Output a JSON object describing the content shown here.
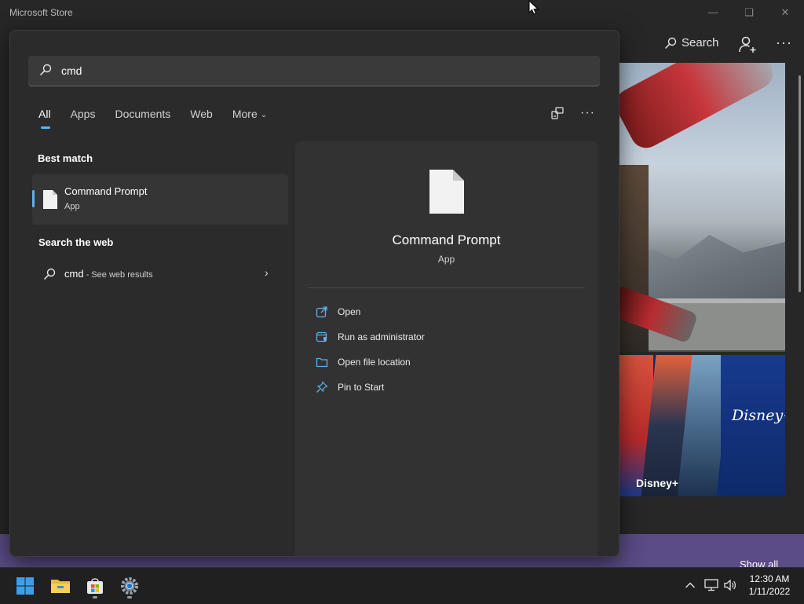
{
  "store": {
    "title": "Microsoft Store",
    "search_label": "Search",
    "promo_label": "Disney+",
    "promo_logo": "Disney+",
    "show_all": "Show all"
  },
  "search": {
    "query": "cmd",
    "tabs": [
      {
        "label": "All",
        "active": true
      },
      {
        "label": "Apps"
      },
      {
        "label": "Documents"
      },
      {
        "label": "Web"
      },
      {
        "label": "More"
      }
    ]
  },
  "results": {
    "best_match_heading": "Best match",
    "best_match": {
      "name": "Command Prompt",
      "type": "App"
    },
    "web_heading": "Search the web",
    "web_result": {
      "query": "cmd",
      "suffix": " - See web results"
    }
  },
  "detail": {
    "name": "Command Prompt",
    "type": "App",
    "actions": [
      {
        "label": "Open",
        "icon": "open-icon"
      },
      {
        "label": "Run as administrator",
        "icon": "shield-admin-icon"
      },
      {
        "label": "Open file location",
        "icon": "folder-icon"
      },
      {
        "label": "Pin to Start",
        "icon": "pin-icon"
      }
    ]
  },
  "taskbar": {
    "time": "12:30 AM",
    "date": "1/11/2022",
    "apps": [
      "start-icon",
      "file-explorer-icon",
      "microsoft-store-icon",
      "settings-icon"
    ]
  },
  "colors": {
    "accent": "#5ab3ee",
    "flyout_bg": "#2b2b2b",
    "detail_bg": "#323232",
    "taskbar_bg": "#202020"
  }
}
